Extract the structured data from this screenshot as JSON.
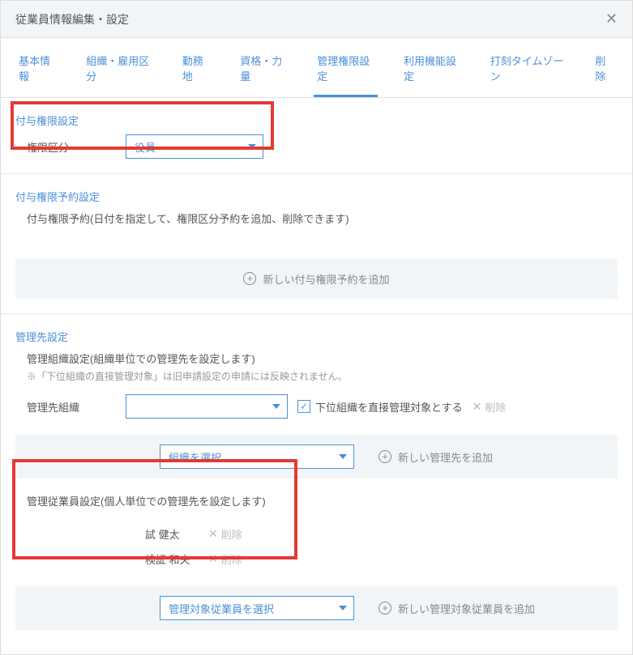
{
  "header": {
    "title": "従業員情報編集・設定"
  },
  "tabs": [
    "基本情報",
    "組織・雇用区分",
    "勤務地",
    "資格・力量",
    "管理権限設定",
    "利用機能設定",
    "打刻タイムゾーン",
    "削除"
  ],
  "activeTab": 4,
  "section1": {
    "title": "付与権限設定",
    "field_label": "権限区分",
    "select_value": "役員"
  },
  "section2": {
    "title": "付与権限予約設定",
    "desc": "付与権限予約(日付を指定して、権限区分予約を追加、削除できます)",
    "add_label": "新しい付与権限予約を追加"
  },
  "section3": {
    "title": "管理先設定",
    "org_heading": "管理組織設定(組織単位での管理先を設定します)",
    "org_note": "※「下位組織の直接管理対象」は旧申請設定の申請には反映されません。",
    "org_label": "管理先組織",
    "org_select_value": "",
    "cb_label": "下位組織を直接管理対象とする",
    "del": "削除",
    "org_picker": "組織を選択",
    "add_org": "新しい管理先を追加",
    "emp_heading": "管理従業員設定(個人単位での管理先を設定します)",
    "employees": [
      {
        "name": "試 健太"
      },
      {
        "name": "検証 和夫"
      }
    ],
    "emp_picker": "管理対象従業員を選択",
    "add_emp": "新しい管理対象従業員を追加"
  }
}
